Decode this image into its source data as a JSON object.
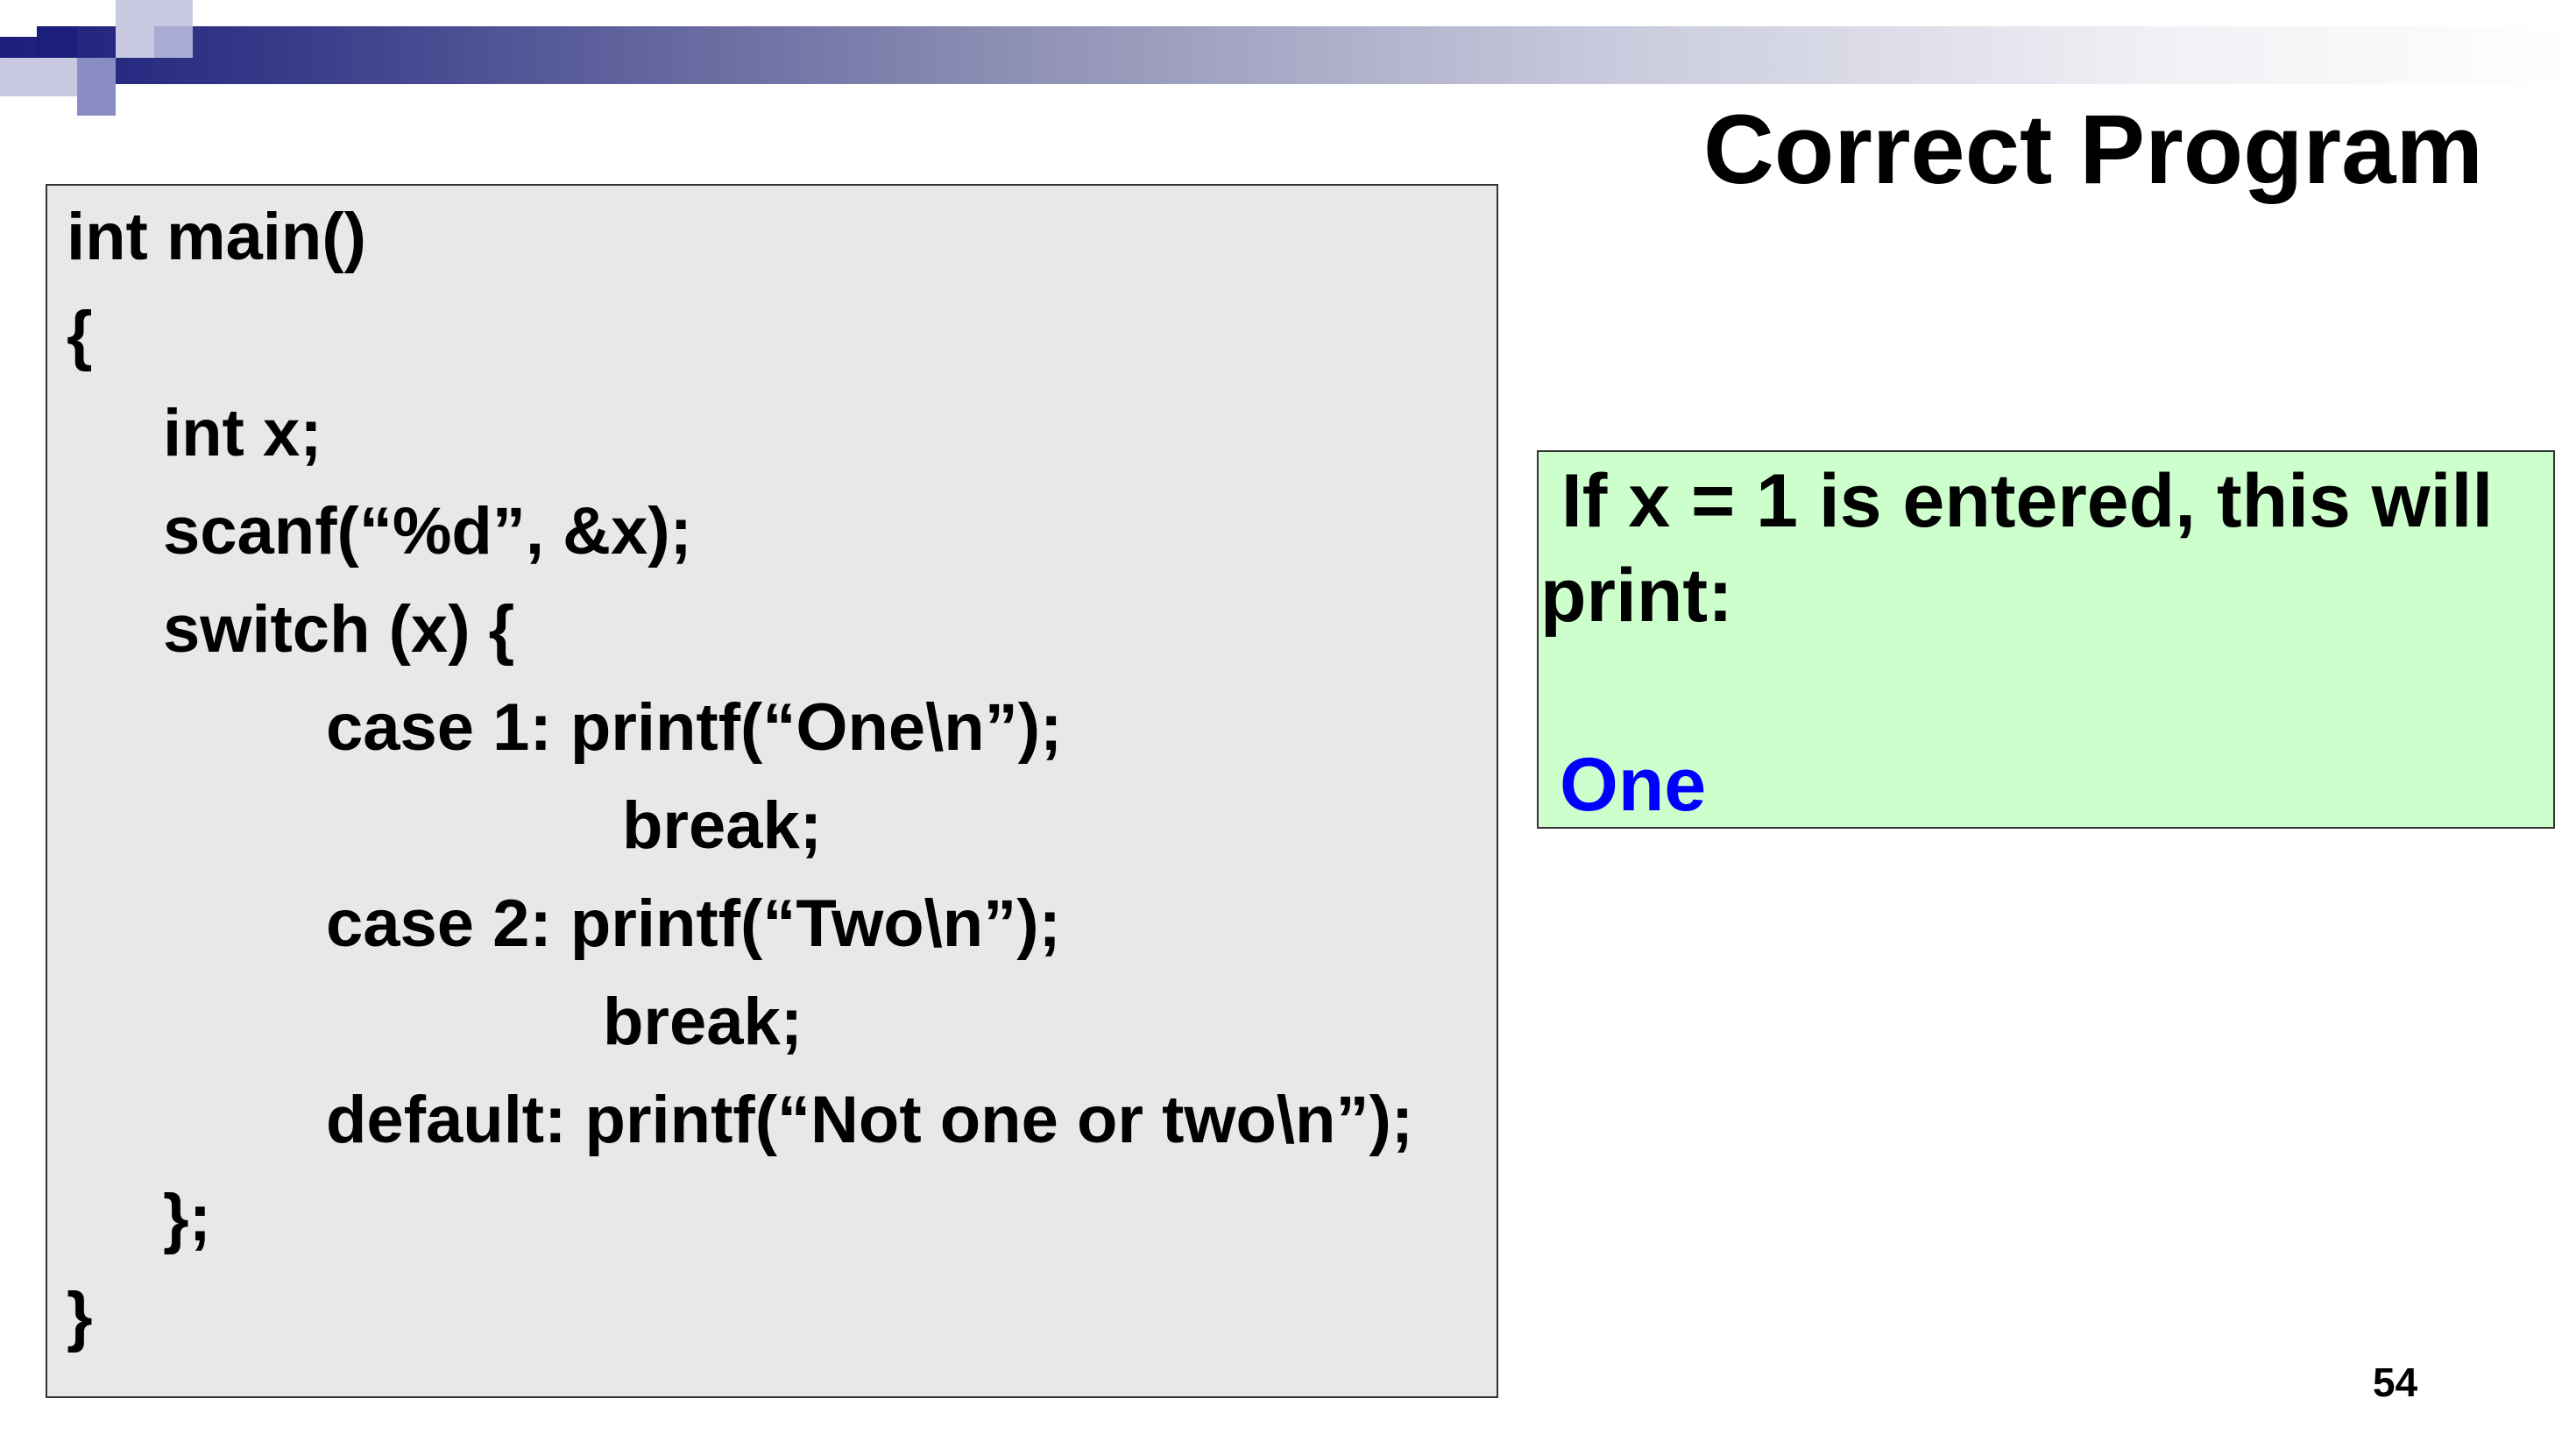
{
  "slide": {
    "title": "Correct Program",
    "page_number": "54"
  },
  "code": {
    "lines": [
      "int main()",
      "{",
      "int x;",
      "scanf(“%d”, &x);",
      "switch (x) {",
      "case 1: printf(“One\\n”);",
      "break;",
      "case 2: printf(“Two\\n”);",
      "break;",
      "default: printf(“Not one or two\\n”);",
      "};",
      "}"
    ]
  },
  "output": {
    "line1": " If x = 1 is entered, this will",
    "line2": "print:",
    "result": "One"
  },
  "colors": {
    "code_background": "#e8e8e8",
    "output_background": "#ccffcc",
    "result_text": "#0000ff",
    "banner_dark": "#1b1e7a"
  }
}
